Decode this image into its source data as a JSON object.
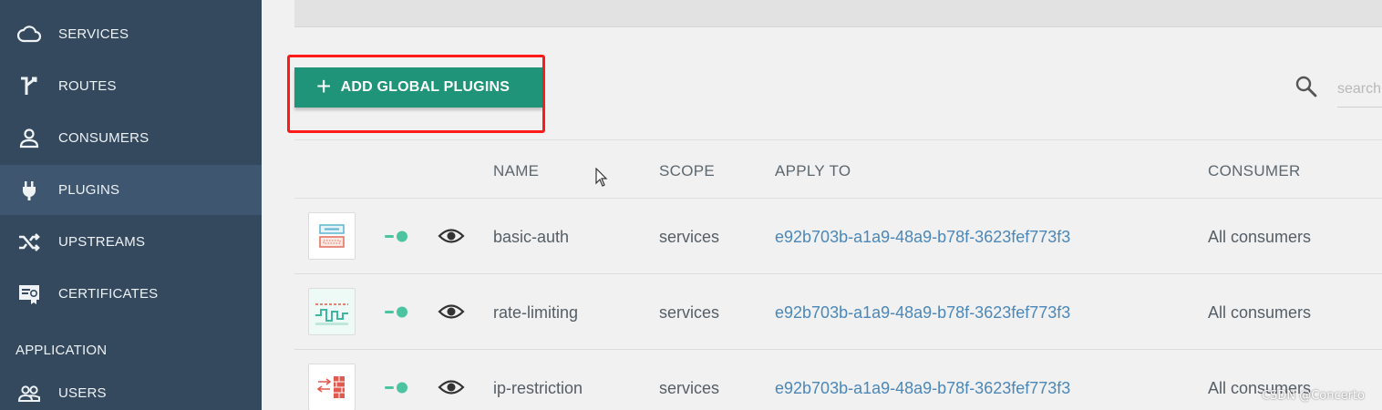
{
  "sidebar": {
    "items": [
      {
        "label": "SERVICES",
        "icon": "cloud-icon"
      },
      {
        "label": "ROUTES",
        "icon": "route-split-icon"
      },
      {
        "label": "CONSUMERS",
        "icon": "person-icon"
      },
      {
        "label": "PLUGINS",
        "icon": "plug-icon",
        "active": true
      },
      {
        "label": "UPSTREAMS",
        "icon": "shuffle-icon"
      },
      {
        "label": "CERTIFICATES",
        "icon": "certificate-icon"
      }
    ],
    "section_label": "APPLICATION",
    "section_items": [
      {
        "label": "USERS",
        "icon": "users-icon"
      }
    ]
  },
  "toolbar": {
    "add_label": "ADD GLOBAL PLUGINS",
    "search_placeholder": "search"
  },
  "table": {
    "headers": [
      "NAME",
      "SCOPE",
      "APPLY TO",
      "CONSUMER"
    ],
    "rows": [
      {
        "icon": "basic-auth-plugin-icon",
        "enabled": true,
        "name": "basic-auth",
        "scope": "services",
        "apply_to": "e92b703b-a1a9-48a9-b78f-3623fef773f3",
        "consumer": "All consumers"
      },
      {
        "icon": "rate-limiting-plugin-icon",
        "enabled": true,
        "name": "rate-limiting",
        "scope": "services",
        "apply_to": "e92b703b-a1a9-48a9-b78f-3623fef773f3",
        "consumer": "All consumers"
      },
      {
        "icon": "ip-restriction-plugin-icon",
        "enabled": true,
        "name": "ip-restriction",
        "scope": "services",
        "apply_to": "e92b703b-a1a9-48a9-b78f-3623fef773f3",
        "consumer": "All consumers"
      }
    ]
  },
  "watermark": "CSDN @Concerto",
  "colors": {
    "sidebar_bg": "#34495e",
    "sidebar_active": "#3f5670",
    "accent_green": "#1f9478",
    "toggle_green": "#4cc4a0",
    "link_blue": "#4b87b9",
    "highlight_red": "#ff1a1a"
  }
}
